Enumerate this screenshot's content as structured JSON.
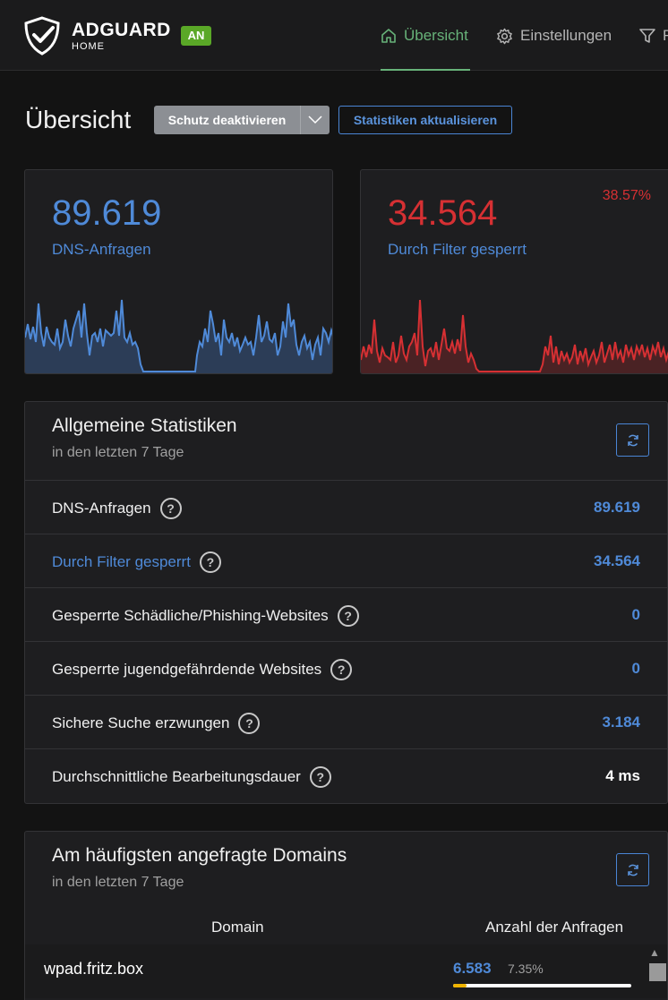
{
  "header": {
    "brand": "ADGUARD",
    "brand_sub": "HOME",
    "badge": "AN",
    "nav": [
      {
        "label": "Übersicht",
        "icon": "home-icon",
        "active": true
      },
      {
        "label": "Einstellungen",
        "icon": "gear-icon",
        "active": false
      },
      {
        "label": "F",
        "icon": "filter-icon",
        "active": false
      }
    ]
  },
  "toolbar": {
    "title": "Übersicht",
    "protect_button": "Schutz deaktivieren",
    "refresh_button": "Statistiken aktualisieren"
  },
  "stat_cards": [
    {
      "value": "89.619",
      "label": "DNS-Anfragen",
      "color": "#4f8ad8"
    },
    {
      "value": "34.564",
      "label": "Durch Filter gesperrt",
      "percent": "38.57%",
      "color": "#d63033"
    }
  ],
  "general_stats": {
    "title": "Allgemeine Statistiken",
    "subtitle": "in den letzten 7 Tage",
    "rows": [
      {
        "label": "DNS-Anfragen",
        "value": "89.619"
      },
      {
        "label": "Durch Filter gesperrt",
        "value": "34.564"
      },
      {
        "label": "Gesperrte Schädliche/Phishing-Websites",
        "value": "0"
      },
      {
        "label": "Gesperrte jugendgefährdende Websites",
        "value": "0"
      },
      {
        "label": "Sichere Suche erzwungen",
        "value": "3.184"
      },
      {
        "label": "Durchschnittliche Bearbeitungsdauer",
        "value": "4 ms"
      }
    ]
  },
  "top_domains": {
    "title": "Am häufigsten angefragte Domains",
    "subtitle": "in den letzten 7 Tage",
    "col_domain": "Domain",
    "col_count": "Anzahl der Anfragen",
    "rows": [
      {
        "domain": "wpad.fritz.box",
        "count": "6.583",
        "percent": "7.35%",
        "fraction": 0.0735
      }
    ]
  },
  "icons": {
    "help": "?"
  }
}
